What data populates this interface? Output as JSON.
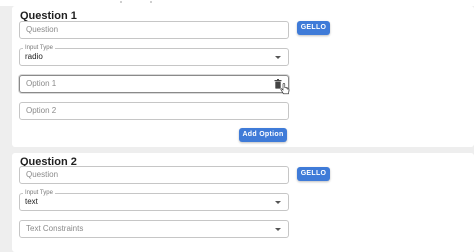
{
  "questions": [
    {
      "title": "Question 1",
      "question_placeholder": "Question",
      "gello_label": "GELLO",
      "input_type_label": "Input Type",
      "input_type_value": "radio",
      "options": [
        {
          "placeholder": "Option 1"
        },
        {
          "placeholder": "Option 2"
        }
      ],
      "add_option_label": "Add Option"
    },
    {
      "title": "Question 2",
      "question_placeholder": "Question",
      "gello_label": "GELLO",
      "input_type_label": "Input Type",
      "input_type_value": "text",
      "constraints_placeholder": "Text Constraints"
    }
  ],
  "colors": {
    "accent": "#3f7bd8",
    "background": "#eeeeee",
    "card": "#ffffff"
  },
  "icons": [
    "trash-icon",
    "chevron-down-icon",
    "hand-cursor-icon"
  ]
}
